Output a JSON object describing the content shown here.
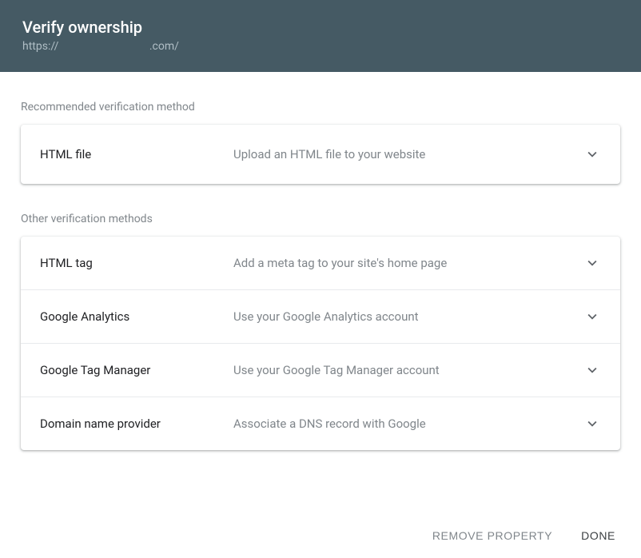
{
  "header": {
    "title": "Verify ownership",
    "url_prefix": "https://",
    "url_suffix": ".com/"
  },
  "sections": {
    "recommended_label": "Recommended verification method",
    "other_label": "Other verification methods"
  },
  "methods": {
    "recommended": {
      "title": "HTML file",
      "desc": "Upload an HTML file to your website"
    },
    "other": [
      {
        "title": "HTML tag",
        "desc": "Add a meta tag to your site's home page"
      },
      {
        "title": "Google Analytics",
        "desc": "Use your Google Analytics account"
      },
      {
        "title": "Google Tag Manager",
        "desc": "Use your Google Tag Manager account"
      },
      {
        "title": "Domain name provider",
        "desc": "Associate a DNS record with Google"
      }
    ]
  },
  "footer": {
    "remove": "Remove property",
    "done": "Done"
  }
}
